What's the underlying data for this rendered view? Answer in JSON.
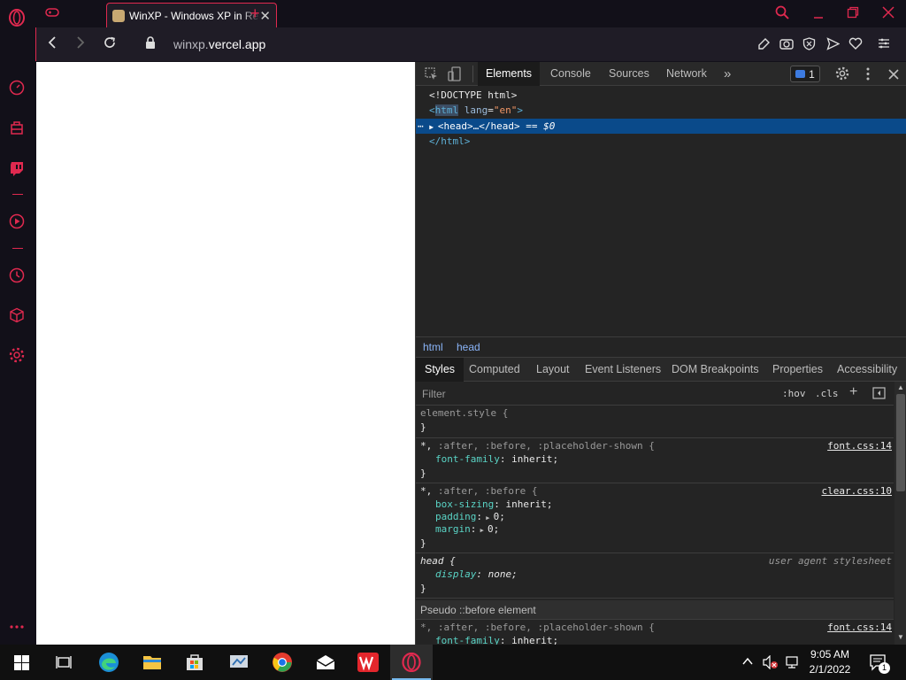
{
  "browser": {
    "tab": {
      "title": "WinXP - Windows XP in React"
    },
    "address": {
      "host_prefix": "winxp.",
      "host_domain": "vercel.app"
    },
    "accent": "#e0294f"
  },
  "devtools": {
    "tabs": [
      "Elements",
      "Console",
      "Sources",
      "Network"
    ],
    "issues_count": "1",
    "dom": {
      "doctype": "<!DOCTYPE html>",
      "html_open_tag": "html",
      "html_attr_name": "lang",
      "html_attr_value": "\"en\"",
      "head_line": "<head>…</head>",
      "head_suffix": "== $0",
      "html_close": "</html>"
    },
    "breadcrumbs": [
      "html",
      "head"
    ],
    "style_tabs": [
      "Styles",
      "Computed",
      "Layout",
      "Event Listeners",
      "DOM Breakpoints",
      "Properties",
      "Accessibility"
    ],
    "filter_placeholder": "Filter",
    "hov": ":hov",
    "cls": ".cls",
    "rules": {
      "r1_selector": "element.style {",
      "close": "}",
      "r2_selector_main": "*,",
      "r2_selector_rest": " :after, :before, :placeholder-shown {",
      "r2_prop": "font-family",
      "r2_val": "inherit;",
      "r2_src": "font.css:14",
      "r3_selector_main": "*,",
      "r3_selector_rest": " :after, :before {",
      "r3_p1": "box-sizing",
      "r3_v1": "inherit;",
      "r3_p2": "padding",
      "r3_v2": "0;",
      "r3_p3": "margin",
      "r3_v3": "0;",
      "r3_src": "clear.css:10",
      "r4_selector": "head {",
      "r4_prop": "display",
      "r4_val": "none;",
      "r4_src": "user agent stylesheet",
      "pseudo_header": "Pseudo ::before element",
      "r5_selector_main": "*,",
      "r5_selector_rest": " :after, :before, :placeholder-shown {",
      "r5_prop": "font-family",
      "r5_val": "inherit;",
      "r5_src": "font.css:14"
    }
  },
  "taskbar": {
    "time": "9:05 AM",
    "date": "2/1/2022",
    "notification_count": "1"
  }
}
